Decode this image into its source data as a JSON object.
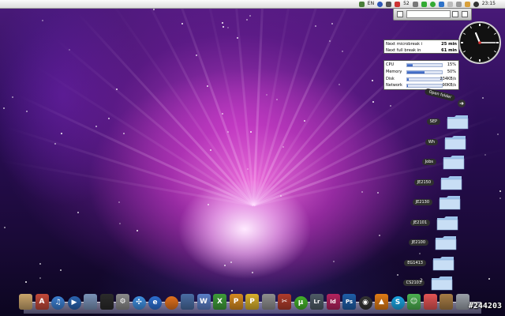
{
  "menubar": {
    "lang": "EN",
    "clock": "23:15",
    "icon_badge": "52"
  },
  "widgets": {
    "break_timer": {
      "rows": [
        {
          "label": "Next microbreak i",
          "value": "25 min"
        },
        {
          "label": "Next full break in",
          "value": "61 min"
        }
      ]
    },
    "system_monitor": {
      "rows": [
        {
          "label": "CPU",
          "value": "15%",
          "fill": 0.15
        },
        {
          "label": "Memory",
          "value": "50%",
          "fill": 0.5
        },
        {
          "label": "Disk",
          "value": "234KB/s",
          "fill": 0.05
        },
        {
          "label": "Network",
          "value": "90KB/s",
          "fill": 0.03
        }
      ]
    },
    "clock": {
      "hour": 11,
      "minute": 15
    }
  },
  "stack": {
    "title": "Open folder",
    "folders": [
      "SEP",
      "Wh",
      "Jobs",
      "JE2150",
      "JE2130",
      "JE2101",
      "JE2100",
      "EG1413",
      "CS2103"
    ]
  },
  "desktop": {
    "label": "2"
  },
  "dock": {
    "items": [
      {
        "name": "finder",
        "color": "#c9a46b",
        "glyph": ""
      },
      {
        "name": "pdf",
        "color": "#c2493a",
        "glyph": "A"
      },
      {
        "name": "itunes",
        "color": "#3b7ed1",
        "glyph": "♫"
      },
      {
        "name": "quicktime",
        "color": "#2a64b0",
        "glyph": "▶"
      },
      {
        "name": "preview",
        "color": "#7a93b8",
        "glyph": ""
      },
      {
        "name": "display",
        "color": "#2b2b2b",
        "glyph": ""
      },
      {
        "name": "gear",
        "color": "#8a8a8a",
        "glyph": "⚙"
      },
      {
        "name": "safari",
        "color": "#3f8fe0",
        "glyph": "✣"
      },
      {
        "name": "ie",
        "color": "#2d6fd1",
        "glyph": "e"
      },
      {
        "name": "firefox",
        "color": "#e2711d",
        "glyph": ""
      },
      {
        "name": "photo",
        "color": "#4a6da3",
        "glyph": ""
      },
      {
        "name": "word",
        "color": "#5b7fc7",
        "glyph": "W"
      },
      {
        "name": "excel",
        "color": "#3f9c3a",
        "glyph": "X"
      },
      {
        "name": "powerpoint",
        "color": "#d68a20",
        "glyph": "P"
      },
      {
        "name": "pages",
        "color": "#d9b02c",
        "glyph": "P"
      },
      {
        "name": "script",
        "color": "#8e8e8e",
        "glyph": ""
      },
      {
        "name": "tools",
        "color": "#b03c2c",
        "glyph": "✂"
      },
      {
        "name": "utorrent",
        "color": "#43b02a",
        "glyph": "µ"
      },
      {
        "name": "lightroom",
        "color": "#4e5b66",
        "glyph": "Lr"
      },
      {
        "name": "indesign",
        "color": "#b4235f",
        "glyph": "Id"
      },
      {
        "name": "photoshop",
        "color": "#1f5ea8",
        "glyph": "Ps"
      },
      {
        "name": "camera",
        "color": "#333333",
        "glyph": "◉"
      },
      {
        "name": "vlc",
        "color": "#e07b16",
        "glyph": "▲"
      },
      {
        "name": "skype",
        "color": "#1aa3e0",
        "glyph": "S"
      },
      {
        "name": "messenger",
        "color": "#4caf50",
        "glyph": "☺"
      },
      {
        "name": "ichat",
        "color": "#e35454",
        "glyph": ""
      },
      {
        "name": "paper",
        "color": "#a67c45",
        "glyph": ""
      },
      {
        "name": "trash",
        "color": "#9aa0a8",
        "glyph": ""
      }
    ]
  },
  "watermark": "#244203"
}
